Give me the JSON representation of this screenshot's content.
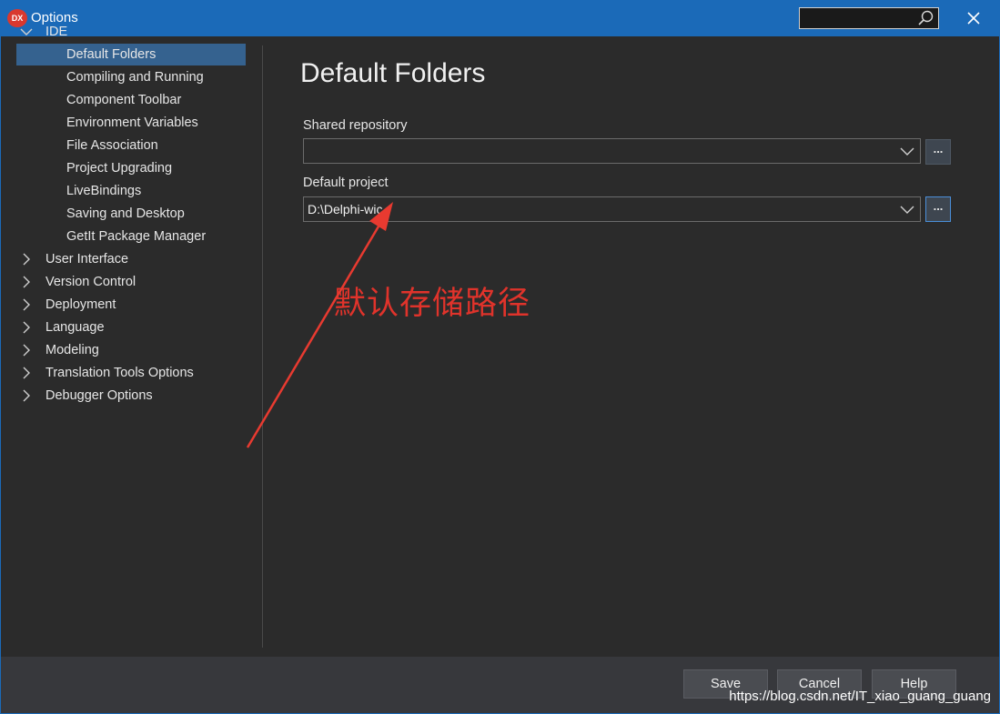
{
  "window": {
    "logo_text": "DX",
    "title": "Options",
    "search_placeholder": ""
  },
  "sidebar": {
    "ide_label": "IDE",
    "ide_children": [
      "Default Folders",
      "Compiling and Running",
      "Component Toolbar",
      "Environment Variables",
      "File Association",
      "Project Upgrading",
      "LiveBindings",
      "Saving and Desktop",
      "GetIt Package Manager"
    ],
    "selected": "Default Folders",
    "top_level": [
      "User Interface",
      "Version Control",
      "Deployment",
      "Language",
      "Modeling",
      "Translation Tools Options",
      "Debugger Options"
    ]
  },
  "main": {
    "page_title": "Default Folders",
    "shared_repository": {
      "label": "Shared repository",
      "value": "",
      "browse_label": "..."
    },
    "default_project": {
      "label": "Default project",
      "value": "D:\\Delphi-wic",
      "browse_label": "..."
    }
  },
  "annotation": {
    "text": "默认存储路径",
    "color": "#e0332b"
  },
  "footer": {
    "save_label": "Save",
    "cancel_label": "Cancel",
    "help_label": "Help"
  },
  "watermark": "https://blog.csdn.net/IT_xiao_guang_guang",
  "colors": {
    "titlebar": "#1b6ab8",
    "background": "#2b2b2b",
    "selection": "#35628f",
    "footer": "#37383c"
  }
}
